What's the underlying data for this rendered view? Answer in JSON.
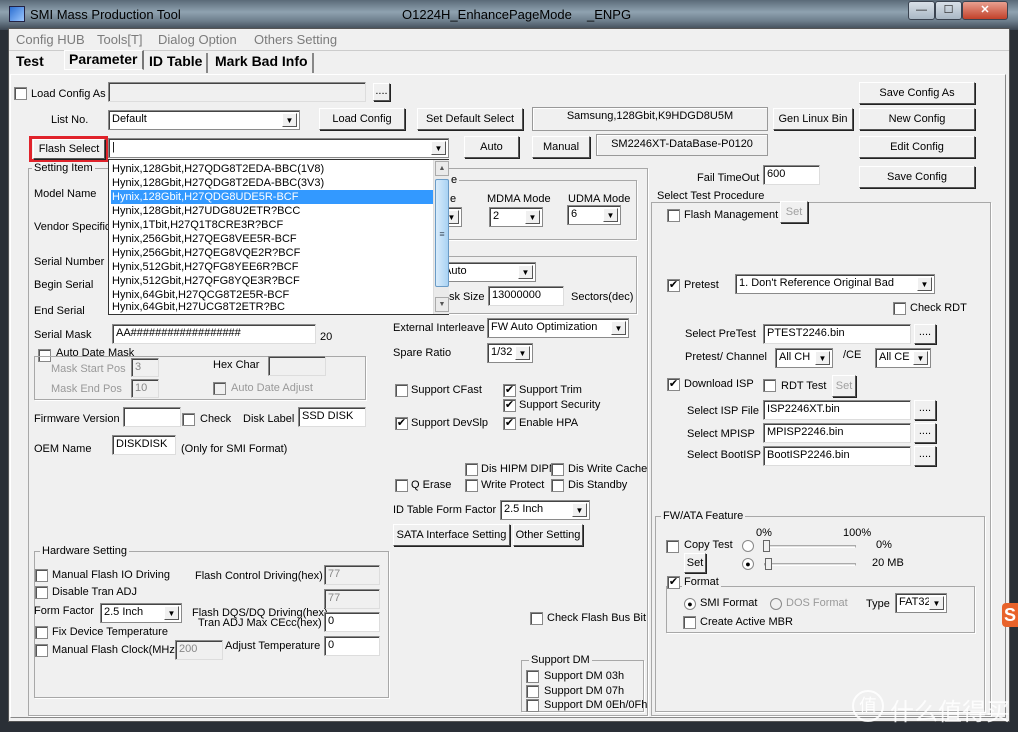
{
  "window": {
    "app_title": "SMI Mass Production Tool",
    "version_title": "O1224H_EnhancePageMode",
    "suffix": "_ENPG",
    "min": "—",
    "max": "☐",
    "close": "✕"
  },
  "menu": [
    "Config HUB",
    "Tools[T]",
    "Dialog Option",
    "Others Setting"
  ],
  "tabs": [
    {
      "label": "Test"
    },
    {
      "label": "Parameter",
      "active": true
    },
    {
      "label": "ID Table"
    },
    {
      "label": "Mark Bad Info"
    }
  ],
  "top": {
    "load_config_as": "Load Config As",
    "load_config_path": "",
    "browse": "....",
    "list_no_label": "List No.",
    "list_no": "Default",
    "load_config": "Load Config",
    "set_default_select": "Set Default Select",
    "current_flash": "Samsung,128Gbit,K9HDGD8U5M",
    "gen_linux_bin": "Gen Linux Bin",
    "save_config_as": "Save Config As",
    "new_config": "New Config",
    "edit_config": "Edit Config",
    "save_config": "Save Config",
    "flash_select": "Flash Select",
    "flash_select_value": "|",
    "auto": "Auto",
    "manual": "Manual",
    "database": "SM2246XT-DataBase-P0120",
    "fail_timeout_label": "Fail TimeOut",
    "fail_timeout": "600",
    "highlight_color": "#e0232b"
  },
  "flash_list": {
    "selected_index": 2,
    "items": [
      "Hynix,128Gbit,H27QDG8T2EDA-BBC(1V8)",
      "Hynix,128Gbit,H27QDG8T2EDA-BBC(3V3)",
      "Hynix,128Gbit,H27QDG8UDE5R-BCF",
      "Hynix,128Gbit,H27UDG8U2ETR?BCC",
      "Hynix,1Tbit,H27Q1T8CRE3R?BCF",
      "Hynix,256Gbit,H27QEG8VEE5R-BCF",
      "Hynix,256Gbit,H27QEG8VQE2R?BCF",
      "Hynix,512Gbit,H27QFG8YEE6R?BCF",
      "Hynix,512Gbit,H27QFG8YQE3R?BCF",
      "Hynix,64Gbit,H27QCG8T2E5R-BCF",
      "Hynix,64Gbit,H27UCG8T2ETR?BC"
    ]
  },
  "setting": {
    "title": "Setting Item",
    "model_name": "Model Name",
    "vendor_specific": "Vendor Specific",
    "serial_number": "Serial Number",
    "begin_serial": "Begin Serial",
    "end_serial": "End Serial",
    "serial_mask_label": "Serial Mask",
    "serial_mask": "AA##################",
    "serial_mask_len": "20",
    "auto_date_mask": "Auto Date Mask",
    "mask_start_pos": "Mask Start Pos",
    "mask_start": "3",
    "mask_end_pos": "Mask End Pos",
    "mask_end": "10",
    "hex_char": "Hex Char",
    "auto_date_adjust": "Auto Date Adjust",
    "firmware_version": "Firmware Version",
    "check": "Check",
    "disk_label_label": "Disk Label",
    "disk_label": "SSD DISK",
    "oem_name_label": "OEM Name",
    "oem_name": "DISKDISK",
    "oem_note": "(Only for SMI Format)"
  },
  "mode": {
    "group_title_tail": "e",
    "pio_tail": "e",
    "mdma_label": "MDMA Mode",
    "mdma": "2",
    "udma_label": "UDMA Mode",
    "udma": "6",
    "capacity_mode": "Auto",
    "disk_size_label_tail": "sk Size",
    "disk_size": "13000000",
    "disk_size_unit": "Sectors(dec)",
    "ext_interleave_label": "External Interleave",
    "ext_interleave": "FW Auto Optimization",
    "spare_ratio_label": "Spare Ratio",
    "spare_ratio": "1/32"
  },
  "features": {
    "support_cfast": {
      "label": "Support CFast",
      "checked": false
    },
    "support_trim": {
      "label": "Support Trim",
      "checked": true
    },
    "support_security": {
      "label": "Support Security",
      "checked": true
    },
    "support_devslp": {
      "label": "Support DevSlp",
      "checked": true
    },
    "enable_hpa": {
      "label": "Enable HPA",
      "checked": true
    },
    "dis_hipm_dipm": {
      "label": "Dis HIPM DIPM",
      "checked": false
    },
    "dis_write_cache": {
      "label": "Dis Write Cache",
      "checked": false
    },
    "q_erase": {
      "label": "Q Erase",
      "checked": false
    },
    "write_protect": {
      "label": "Write Protect",
      "checked": false
    },
    "dis_standby": {
      "label": "Dis Standby",
      "checked": false
    },
    "id_form_factor_label": "ID Table Form Factor",
    "id_form_factor": "2.5 Inch",
    "sata_interface_setting": "SATA Interface Setting",
    "other_setting": "Other Setting",
    "check_flash_bus_bit": "Check Flash Bus Bit"
  },
  "support_dm": {
    "title": "Support DM",
    "items": [
      "Support DM 03h",
      "Support DM 07h",
      "Support DM 0Eh/0Fh"
    ]
  },
  "hardware": {
    "title": "Hardware Setting",
    "manual_flash_io": "Manual Flash IO Driving",
    "flash_control_driving_label": "Flash Control Driving(hex)",
    "flash_control_driving": "77",
    "disable_tran_adj": "Disable Tran ADJ",
    "flash_dqs_value": "77",
    "form_factor_label": "Form Factor",
    "form_factor": "2.5 Inch",
    "flash_dqs_label": "Flash DQS/DQ Driving(hex)",
    "tran_adj_label": "Tran ADJ Max CEcc(hex)",
    "tran_adj": "0",
    "fix_device_temp": "Fix Device Temperature",
    "manual_flash_clock": "Manual Flash Clock(MHz)",
    "flash_clock": "200",
    "adjust_temp_label": "Adjust Temperature",
    "adjust_temp": "0"
  },
  "procedure": {
    "title": "Select Test Procedure",
    "flash_management": "Flash Management",
    "set": "Set",
    "pretest": "Pretest",
    "pretest_mode": "1. Don't Reference Original Bad",
    "check_rdt": "Check RDT",
    "select_pretest_label": "Select PreTest",
    "pretest_file": "PTEST2246.bin",
    "browse": "....",
    "pretest_channel_label": "Pretest/ Channel",
    "channel": "All CH",
    "ce_label": "/CE",
    "ce": "All CE",
    "download_isp": "Download ISP",
    "rdt_test": "RDT Test",
    "select_isp_label": "Select ISP File",
    "isp_file": "ISP2246XT.bin",
    "select_mpisp_label": "Select MPISP",
    "mpisp_file": "MPISP2246.bin",
    "select_bootisp_label": "Select BootISP",
    "bootisp_file": "BootISP2246.bin"
  },
  "fwata": {
    "title": "FW/ATA Feature",
    "scale_min": "0%",
    "scale_max": "100%",
    "copy_test": "Copy Test",
    "percent_value": "0%",
    "size_value": "20 MB",
    "set": "Set",
    "format": "Format",
    "smi_format": "SMI Format",
    "dos_format": "DOS Format",
    "type_label": "Type",
    "type": "FAT32",
    "create_active_mbr": "Create Active MBR",
    "percent_slider": 0,
    "size_slider": 0.02
  },
  "watermark": {
    "logo_char": "值",
    "text": "什么值得买",
    "side_badge": "S"
  }
}
